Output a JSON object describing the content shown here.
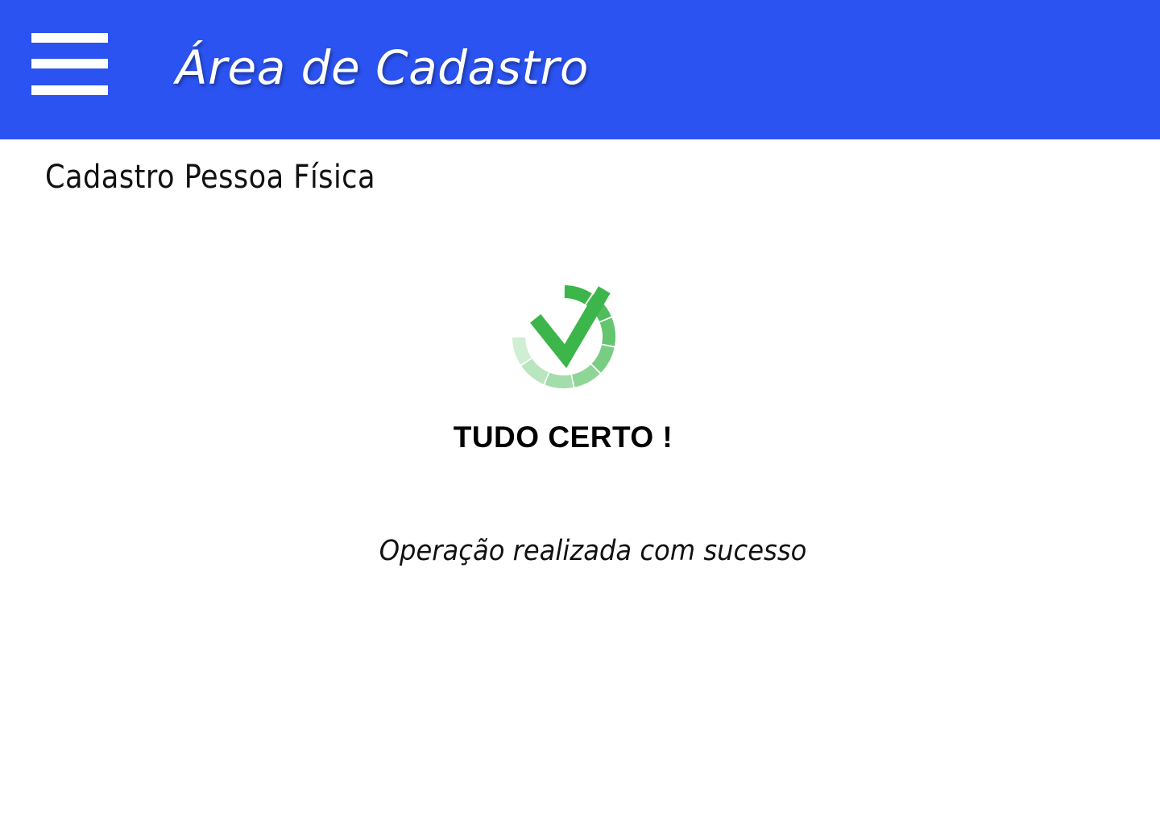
{
  "header": {
    "title": "Área de Cadastro",
    "menu_icon": "hamburger-menu-icon",
    "background_color": "#2b53f1"
  },
  "page": {
    "title": "Cadastro Pessoa Física"
  },
  "status": {
    "icon": "check-circle-icon",
    "heading": "TUDO CERTO !",
    "message": "Operação realizada com sucesso",
    "accent_color": "#3cb54a"
  }
}
